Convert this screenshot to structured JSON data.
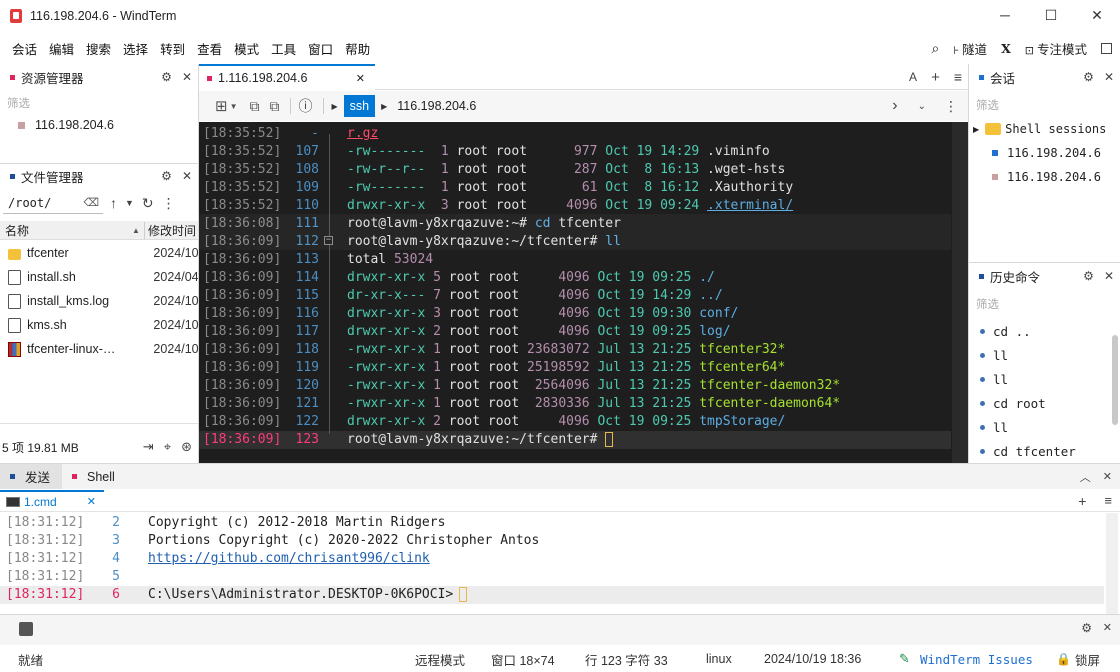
{
  "window": {
    "title": "116.198.204.6 - WindTerm",
    "minimize": "─",
    "maximize": "☐",
    "close": "✕"
  },
  "menu": {
    "items": [
      "会话",
      "编辑",
      "搜索",
      "选择",
      "转到",
      "查看",
      "模式",
      "工具",
      "窗口",
      "帮助"
    ],
    "right": {
      "search": "⌕",
      "tunnel": "隧道",
      "x": "X",
      "focus": "专注模式"
    }
  },
  "explorer": {
    "title": "资源管理器",
    "filter": "筛选",
    "host": "116.198.204.6"
  },
  "filemgr": {
    "title": "文件管理器",
    "path": "/root/",
    "col_name": "名称",
    "col_time": "修改时间",
    "files": [
      {
        "name": "tfcenter",
        "date": "2024/10",
        "type": "folder"
      },
      {
        "name": "install.sh",
        "date": "2024/04",
        "type": "doc"
      },
      {
        "name": "install_kms.log",
        "date": "2024/10",
        "type": "doc"
      },
      {
        "name": "kms.sh",
        "date": "2024/10",
        "type": "doc"
      },
      {
        "name": "tfcenter-linux-…",
        "date": "2024/10",
        "type": "zip"
      }
    ],
    "footer": "5 项 19.81 MB"
  },
  "tab": {
    "label": "1.116.198.204.6",
    "close": "✕",
    "tools": "A",
    "add": "+",
    "menu": "≡"
  },
  "toolbar": {
    "proto": "ssh",
    "host": "116.198.204.6"
  },
  "terminal_lines": [
    {
      "ts": "[18:35:52]",
      "ln": "-",
      "spans": [
        {
          "t": "r.gz",
          "c": "red"
        }
      ]
    },
    {
      "ts": "[18:35:52]",
      "ln": "107",
      "spans": [
        {
          "t": "-rw------- ",
          "c": "perm"
        },
        {
          "t": " 1 ",
          "c": "num"
        },
        {
          "t": "root root      ",
          "c": "fg"
        },
        {
          "t": "977 ",
          "c": "num"
        },
        {
          "t": "Oct 19 14:29 ",
          "c": "perm"
        },
        {
          "t": ".viminfo",
          "c": "fg"
        }
      ]
    },
    {
      "ts": "[18:35:52]",
      "ln": "108",
      "spans": [
        {
          "t": "-rw-r--r-- ",
          "c": "perm"
        },
        {
          "t": " 1 ",
          "c": "num"
        },
        {
          "t": "root root      ",
          "c": "fg"
        },
        {
          "t": "287 ",
          "c": "num"
        },
        {
          "t": "Oct  8 16:13 ",
          "c": "perm"
        },
        {
          "t": ".wget-hsts",
          "c": "fg"
        }
      ]
    },
    {
      "ts": "[18:35:52]",
      "ln": "109",
      "spans": [
        {
          "t": "-rw------- ",
          "c": "perm"
        },
        {
          "t": " 1 ",
          "c": "num"
        },
        {
          "t": "root root       ",
          "c": "fg"
        },
        {
          "t": "61 ",
          "c": "num"
        },
        {
          "t": "Oct  8 16:12 ",
          "c": "perm"
        },
        {
          "t": ".Xauthority",
          "c": "fg"
        }
      ]
    },
    {
      "ts": "[18:35:52]",
      "ln": "110",
      "spans": [
        {
          "t": "drwxr-xr-x ",
          "c": "perm"
        },
        {
          "t": " 3 ",
          "c": "num"
        },
        {
          "t": "root root     ",
          "c": "fg"
        },
        {
          "t": "4096 ",
          "c": "num"
        },
        {
          "t": "Oct 19 09:24 ",
          "c": "perm"
        },
        {
          "t": ".xterminal/",
          "c": "blue"
        }
      ]
    },
    {
      "ts": "[18:36:08]",
      "ln": "111",
      "spans": [
        {
          "t": "root@lavm-y8xrqazuve:~# ",
          "c": "fg"
        },
        {
          "t": "cd ",
          "c": "blue"
        },
        {
          "t": "tfcenter",
          "c": "fg"
        }
      ]
    },
    {
      "ts": "[18:36:09]",
      "ln": "112",
      "spans": [
        {
          "t": "root@lavm-y8xrqazuve:~/tfcenter# ",
          "c": "fg"
        },
        {
          "t": "ll",
          "c": "blue"
        }
      ]
    },
    {
      "ts": "[18:36:09]",
      "ln": "113",
      "spans": [
        {
          "t": "total ",
          "c": "fg"
        },
        {
          "t": "53024",
          "c": "num"
        }
      ]
    },
    {
      "ts": "[18:36:09]",
      "ln": "114",
      "spans": [
        {
          "t": "drwxr-xr-x ",
          "c": "perm"
        },
        {
          "t": "5 ",
          "c": "num"
        },
        {
          "t": "root root     ",
          "c": "fg"
        },
        {
          "t": "4096 ",
          "c": "num"
        },
        {
          "t": "Oct 19 09:25 ",
          "c": "perm"
        },
        {
          "t": "./",
          "c": "blue"
        }
      ]
    },
    {
      "ts": "[18:36:09]",
      "ln": "115",
      "spans": [
        {
          "t": "dr-xr-x--- ",
          "c": "perm"
        },
        {
          "t": "7 ",
          "c": "num"
        },
        {
          "t": "root root     ",
          "c": "fg"
        },
        {
          "t": "4096 ",
          "c": "num"
        },
        {
          "t": "Oct 19 14:29 ",
          "c": "perm"
        },
        {
          "t": "../",
          "c": "blue"
        }
      ]
    },
    {
      "ts": "[18:36:09]",
      "ln": "116",
      "spans": [
        {
          "t": "drwxr-xr-x ",
          "c": "perm"
        },
        {
          "t": "3 ",
          "c": "num"
        },
        {
          "t": "root root     ",
          "c": "fg"
        },
        {
          "t": "4096 ",
          "c": "num"
        },
        {
          "t": "Oct 19 09:30 ",
          "c": "perm"
        },
        {
          "t": "conf/",
          "c": "blue"
        }
      ]
    },
    {
      "ts": "[18:36:09]",
      "ln": "117",
      "spans": [
        {
          "t": "drwxr-xr-x ",
          "c": "perm"
        },
        {
          "t": "2 ",
          "c": "num"
        },
        {
          "t": "root root     ",
          "c": "fg"
        },
        {
          "t": "4096 ",
          "c": "num"
        },
        {
          "t": "Oct 19 09:25 ",
          "c": "perm"
        },
        {
          "t": "log/",
          "c": "blue"
        }
      ]
    },
    {
      "ts": "[18:36:09]",
      "ln": "118",
      "spans": [
        {
          "t": "-rwxr-xr-x ",
          "c": "perm"
        },
        {
          "t": "1 ",
          "c": "num"
        },
        {
          "t": "root root ",
          "c": "fg"
        },
        {
          "t": "23683072 ",
          "c": "num"
        },
        {
          "t": "Jul 13 21:25 ",
          "c": "perm"
        },
        {
          "t": "tfcenter32*",
          "c": "grn"
        }
      ]
    },
    {
      "ts": "[18:36:09]",
      "ln": "119",
      "spans": [
        {
          "t": "-rwxr-xr-x ",
          "c": "perm"
        },
        {
          "t": "1 ",
          "c": "num"
        },
        {
          "t": "root root ",
          "c": "fg"
        },
        {
          "t": "25198592 ",
          "c": "num"
        },
        {
          "t": "Jul 13 21:25 ",
          "c": "perm"
        },
        {
          "t": "tfcenter64*",
          "c": "grn"
        }
      ]
    },
    {
      "ts": "[18:36:09]",
      "ln": "120",
      "spans": [
        {
          "t": "-rwxr-xr-x ",
          "c": "perm"
        },
        {
          "t": "1 ",
          "c": "num"
        },
        {
          "t": "root root  ",
          "c": "fg"
        },
        {
          "t": "2564096 ",
          "c": "num"
        },
        {
          "t": "Jul 13 21:25 ",
          "c": "perm"
        },
        {
          "t": "tfcenter-daemon32*",
          "c": "grn"
        }
      ]
    },
    {
      "ts": "[18:36:09]",
      "ln": "121",
      "spans": [
        {
          "t": "-rwxr-xr-x ",
          "c": "perm"
        },
        {
          "t": "1 ",
          "c": "num"
        },
        {
          "t": "root root  ",
          "c": "fg"
        },
        {
          "t": "2830336 ",
          "c": "num"
        },
        {
          "t": "Jul 13 21:25 ",
          "c": "perm"
        },
        {
          "t": "tfcenter-daemon64*",
          "c": "grn"
        }
      ]
    },
    {
      "ts": "[18:36:09]",
      "ln": "122",
      "spans": [
        {
          "t": "drwxr-xr-x ",
          "c": "perm"
        },
        {
          "t": "2 ",
          "c": "num"
        },
        {
          "t": "root root     ",
          "c": "fg"
        },
        {
          "t": "4096 ",
          "c": "num"
        },
        {
          "t": "Oct 19 09:25 ",
          "c": "perm"
        },
        {
          "t": "tmpStorage/",
          "c": "blue"
        }
      ]
    },
    {
      "ts": "[18:36:09]",
      "ln": "123",
      "spans": [
        {
          "t": "root@lavm-y8xrqazuve:~/tfcenter# ",
          "c": "fg"
        }
      ]
    }
  ],
  "bottom": {
    "tab_send": "发送",
    "tab_shell": "Shell",
    "cmd_tab": "1.cmd",
    "lines": [
      {
        "ts": "[18:31:12]",
        "ln": "2",
        "text": "Copyright (c) 2012-2018 Martin Ridgers"
      },
      {
        "ts": "[18:31:12]",
        "ln": "3",
        "text": "Portions Copyright (c) 2020-2022 Christopher Antos"
      },
      {
        "ts": "[18:31:12]",
        "ln": "4",
        "text": "https://github.com/chrisant996/clink"
      },
      {
        "ts": "[18:31:12]",
        "ln": "5",
        "text": ""
      },
      {
        "ts": "[18:31:12]",
        "ln": "6",
        "text": "C:\\Users\\Administrator.DESKTOP-0K6POCI>"
      }
    ]
  },
  "sessions": {
    "title": "会话",
    "filter": "筛选",
    "group": "Shell sessions",
    "items": [
      "116.198.204.6",
      "116.198.204.6"
    ]
  },
  "history": {
    "title": "历史命令",
    "filter": "筛选",
    "items": [
      "cd ..",
      "ll",
      "ll",
      "cd root",
      "ll",
      "cd tfcenter"
    ]
  },
  "status": {
    "ready": "就绪",
    "remote": "远程模式",
    "window": "窗口 18×74",
    "position": "行 123 字符 33",
    "os": "linux",
    "datetime": "2024/10/19 18:36",
    "issues": "WindTerm Issues",
    "lock": "锁屏"
  },
  "colors": {
    "accent": "#0078d4",
    "term_bg": "#1e1e1e",
    "explorer_dot": "#e0245e",
    "session_blue": "#1f6fd0"
  }
}
